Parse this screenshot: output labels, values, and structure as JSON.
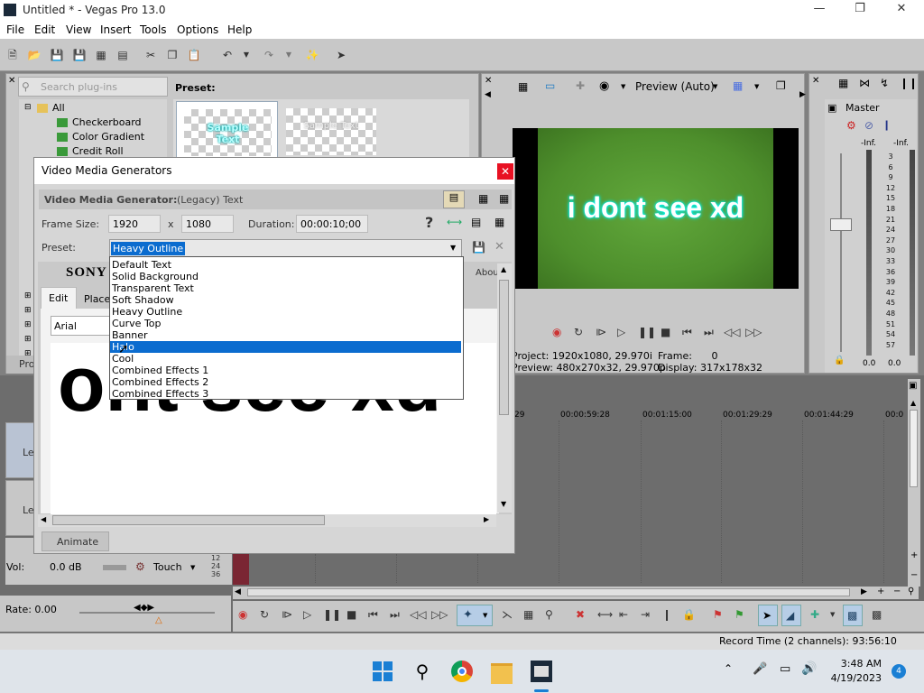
{
  "window": {
    "title": "Untitled * - Vegas Pro 13.0"
  },
  "menu": [
    "File",
    "Edit",
    "View",
    "Insert",
    "Tools",
    "Options",
    "Help"
  ],
  "plugin_pane": {
    "search_placeholder": "Search plug-ins",
    "preset_label": "Preset:",
    "tree": [
      {
        "label": "All"
      },
      {
        "label": "Checkerboard"
      },
      {
        "label": "Color Gradient"
      },
      {
        "label": "Credit Roll"
      }
    ],
    "thumb1_text": "Sample Text",
    "thumb2_text": "Sample Text",
    "tab_short": "Pro"
  },
  "preview": {
    "mode_label": "Preview (Auto)",
    "video_text": "i dont see xd",
    "project_label": "Project:",
    "project_value": "1920x1080, 29.970i",
    "preview_label": "Preview:",
    "preview_value": "480x270x32, 29.970p",
    "frame_label": "Frame:",
    "frame_value": "0",
    "display_label": "Display:",
    "display_value": "317x178x32"
  },
  "mixer": {
    "title": "Master",
    "left_level": "-Inf.",
    "right_level": "-Inf.",
    "scale": [
      "3",
      "6",
      "9",
      "12",
      "15",
      "18",
      "21",
      "24",
      "27",
      "30",
      "33",
      "36",
      "39",
      "42",
      "45",
      "48",
      "51",
      "54",
      "57"
    ],
    "left_value": "0.0",
    "right_value": "0.0"
  },
  "dialog": {
    "title": "Video Media Generators",
    "generator_label": "Video Media Generator:",
    "generator_value": "(Legacy) Text",
    "frame_size_label": "Frame Size:",
    "width": "1920",
    "x_sep": "x",
    "height": "1080",
    "duration_label": "Duration:",
    "duration": "00:00:10;00",
    "preset_label": "Preset:",
    "preset_value": "Heavy Outline",
    "preset_options": [
      "Default Text",
      "Solid Background",
      "Transparent Text",
      "Soft Shadow",
      "Heavy Outline",
      "Curve Top",
      "Banner",
      "Halo",
      "Cool",
      "Combined Effects 1",
      "Combined Effects 2",
      "Combined Effects 3"
    ],
    "hovered_option_index": 7,
    "sony_text": "SONY",
    "about_label": "About",
    "tab_edit": "Edit",
    "tab_placement": "Place",
    "font_value": "Arial",
    "canvas_text": "ont see xd",
    "animate_label": "Animate"
  },
  "tracks": {
    "track_label_1": "Le",
    "track_label_2": "Le",
    "vol_label": "Vol:",
    "vol_value": "0.0 dB",
    "touch_label": "Touch",
    "rate_label": "Rate: 0.00"
  },
  "timeline": {
    "ruler": [
      "29",
      "00:00:59:28",
      "00:01:15:00",
      "00:01:29:29",
      "00:01:44:29",
      "00:0"
    ],
    "mini_ruler": [
      "12",
      "24",
      "36"
    ]
  },
  "status": {
    "record_time": "Record Time (2 channels): 93:56:10"
  },
  "taskbar": {
    "time": "3:48 AM",
    "date": "4/19/2023",
    "badge": "4"
  }
}
